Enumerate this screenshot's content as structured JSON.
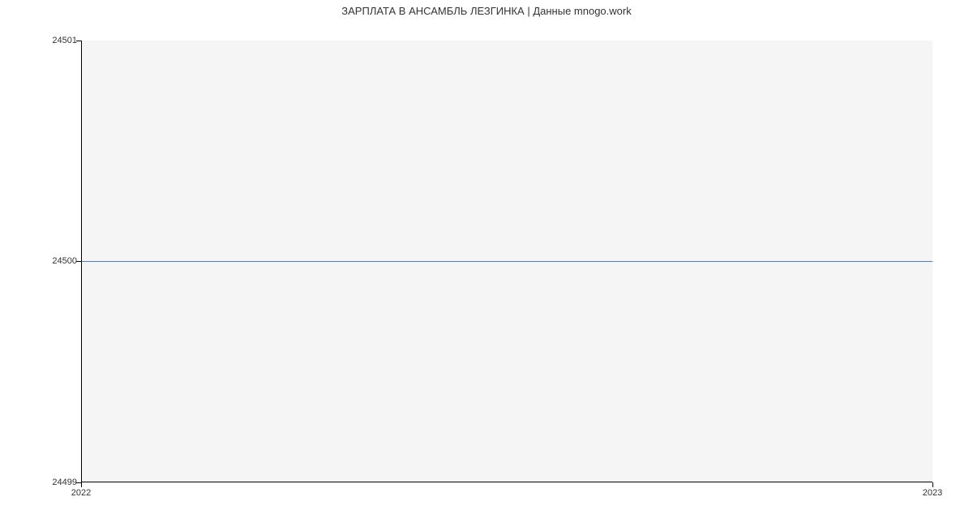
{
  "chart_data": {
    "type": "line",
    "title": "ЗАРПЛАТА В АНСАМБЛЬ ЛЕЗГИНКА | Данные mnogo.work",
    "x": [
      "2022",
      "2023"
    ],
    "values": [
      24500,
      24500
    ],
    "xlabel": "",
    "ylabel": "",
    "ylim": [
      24499,
      24501
    ],
    "y_ticks": [
      "24499",
      "24500",
      "24501"
    ],
    "x_ticks": [
      "2022",
      "2023"
    ],
    "line_color": "#4a7fc4",
    "grid_bg": "#f5f5f5"
  }
}
